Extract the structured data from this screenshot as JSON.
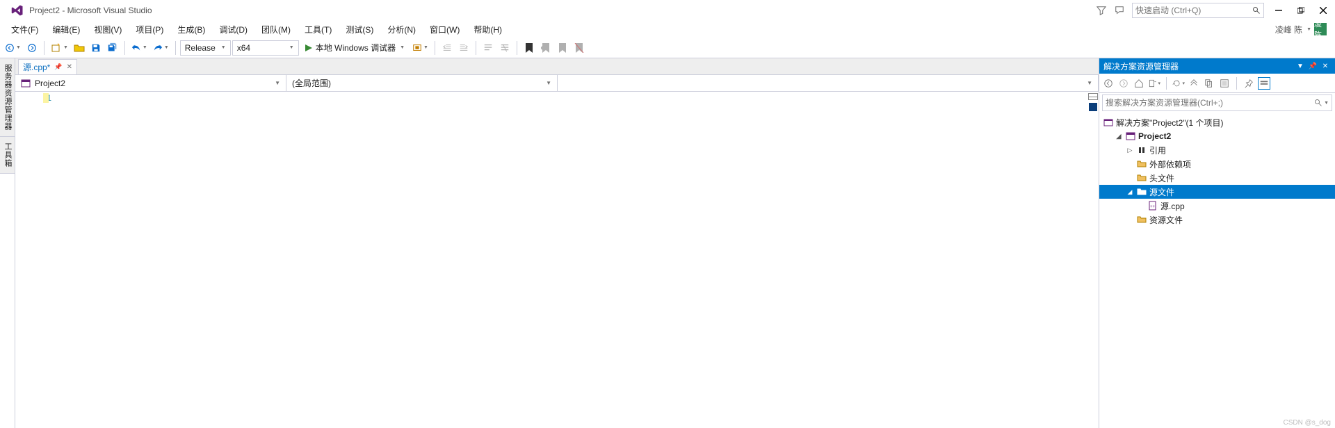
{
  "title": "Project2 - Microsoft Visual Studio",
  "quicklaunch_placeholder": "快速启动 (Ctrl+Q)",
  "user_name": "凌峰 陈",
  "user_initial": "凌陈",
  "menu": [
    "文件(F)",
    "编辑(E)",
    "视图(V)",
    "项目(P)",
    "生成(B)",
    "调试(D)",
    "团队(M)",
    "工具(T)",
    "测试(S)",
    "分析(N)",
    "窗口(W)",
    "帮助(H)"
  ],
  "config": "Release",
  "platform": "x64",
  "run_label": "本地 Windows 调试器",
  "left_tabs": [
    "服务器资源管理器",
    "工具箱"
  ],
  "file_tab": "源.cpp*",
  "breadcrumb": {
    "project": "Project2",
    "scope": "(全局范围)",
    "member": ""
  },
  "gutter_lines": [
    "1"
  ],
  "panel": {
    "title": "解决方案资源管理器",
    "search_placeholder": "搜索解决方案资源管理器(Ctrl+;)",
    "solution": "解决方案\"Project2\"(1 个项目)",
    "project": "Project2",
    "refs": "引用",
    "external": "外部依赖项",
    "headers": "头文件",
    "sources": "源文件",
    "source_file": "源.cpp",
    "resources": "资源文件"
  },
  "watermark": "CSDN @s_dog"
}
